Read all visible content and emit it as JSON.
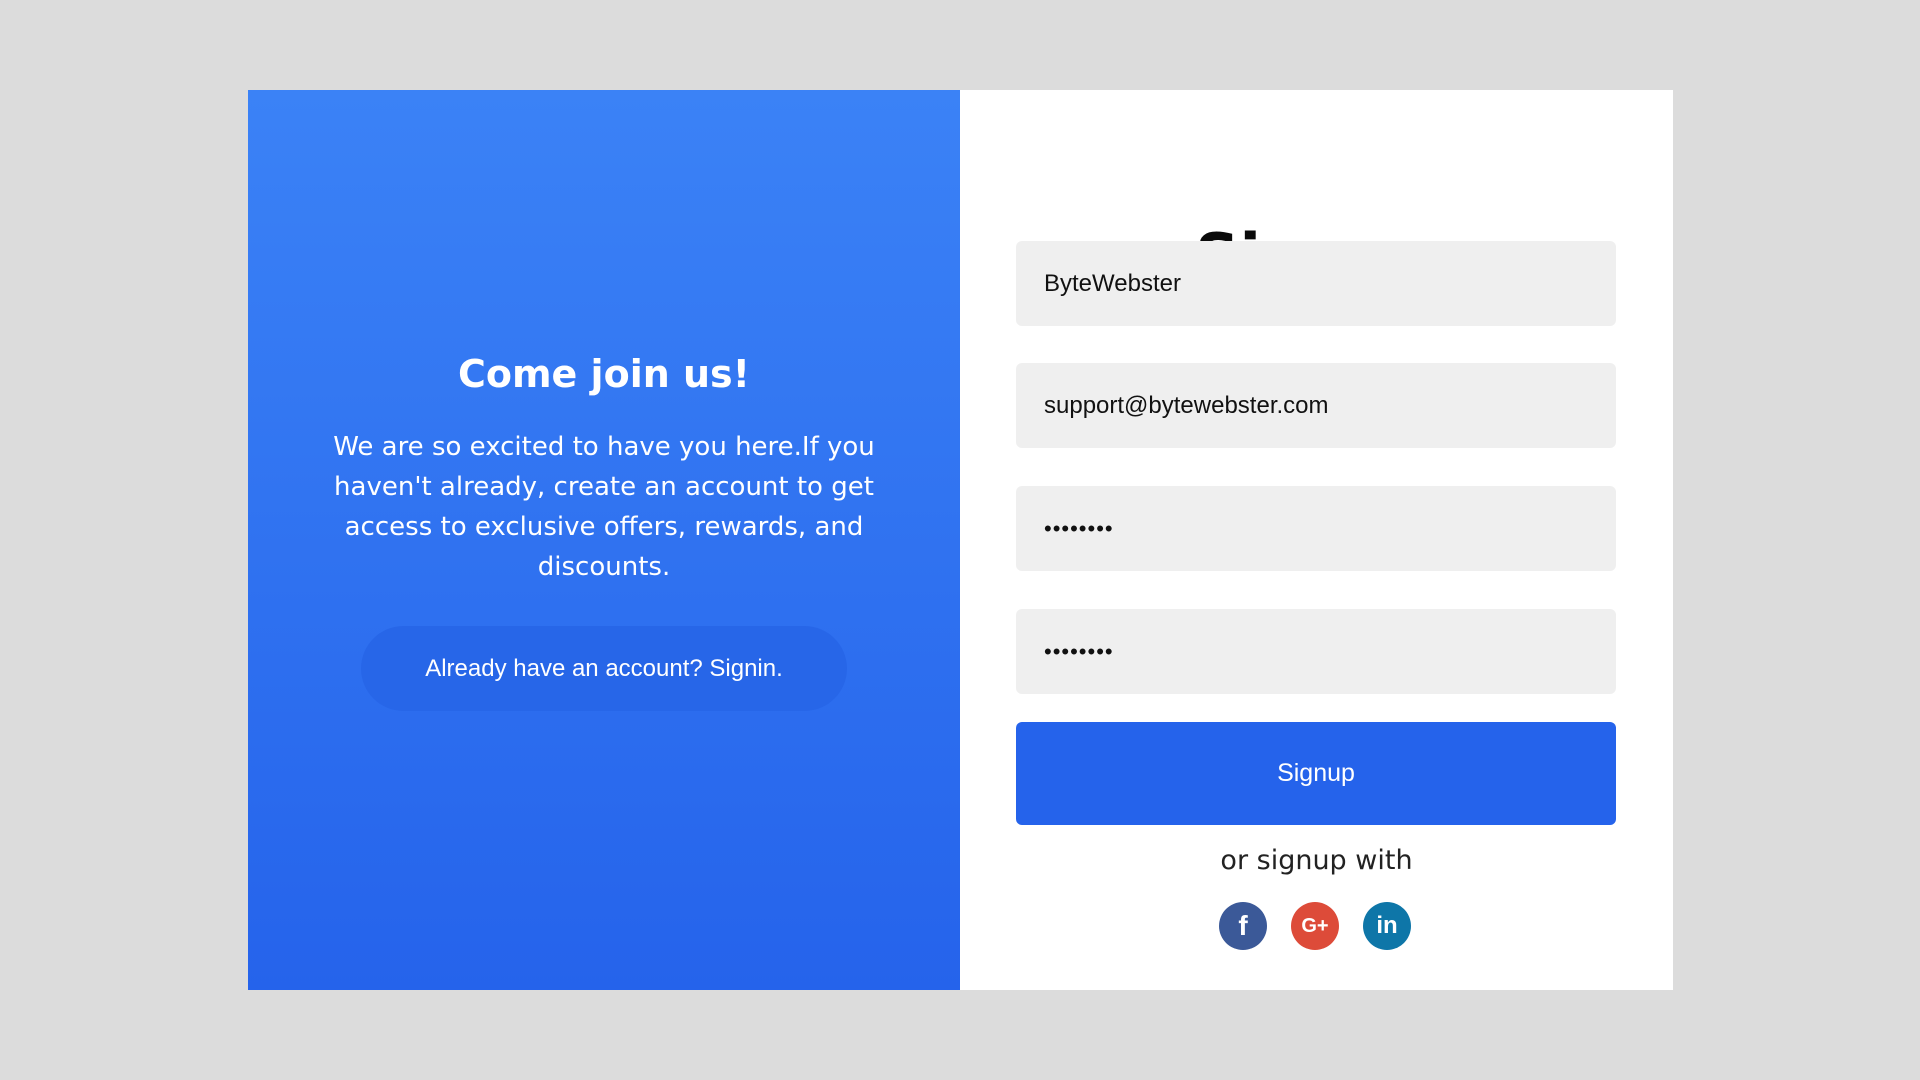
{
  "left": {
    "title": "Come join us!",
    "description": "We are so excited to have you here.If you haven't already, create an account to get access to exclusive offers, rewards, and discounts.",
    "signin_label": "Already have an account? Signin."
  },
  "form": {
    "title": "Signup",
    "username_value": "ByteWebster",
    "email_value": "support@bytewebster.com",
    "password_value": "password",
    "confirm_password_value": "password",
    "submit_label": "Signup",
    "or_text": "or signup with"
  },
  "social": [
    {
      "icon": "facebook-icon",
      "glyph": "f",
      "color": "#3b5998"
    },
    {
      "icon": "google-plus-icon",
      "glyph": "G+",
      "color": "#dd4b39"
    },
    {
      "icon": "linkedin-icon",
      "glyph": "in",
      "color": "#0e76a8"
    }
  ],
  "colors": {
    "background": "#dcdcdc",
    "left_gradient_top": "#3b82f6",
    "left_gradient_bottom": "#2563eb",
    "primary_button": "#2563eb",
    "input_background": "#efefef"
  }
}
